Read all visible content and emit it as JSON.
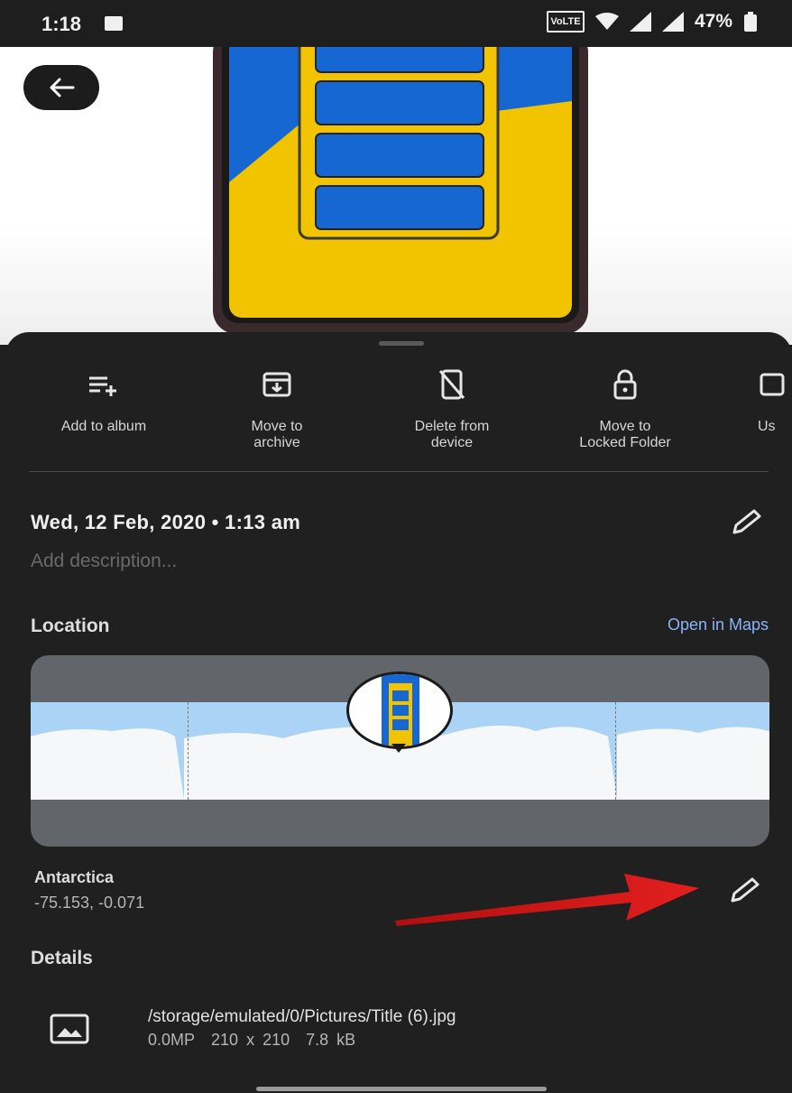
{
  "status_bar": {
    "time": "1:18",
    "network": "VoLTE",
    "battery": "47%"
  },
  "photo": {
    "subject": "phone-with-battery-graphic"
  },
  "actions": [
    {
      "label": "Add to album",
      "icon": "playlist-add-icon"
    },
    {
      "label": "Move to\narchive",
      "icon": "archive-icon"
    },
    {
      "label": "Delete from\ndevice",
      "icon": "delete-device-icon"
    },
    {
      "label": "Move to\nLocked Folder",
      "icon": "lock-icon"
    },
    {
      "label": "Us",
      "icon": "use-as-icon"
    }
  ],
  "info": {
    "date_time": "Wed, 12 Feb, 2020 • 1:13 am",
    "description_placeholder": "Add description..."
  },
  "location": {
    "title": "Location",
    "open_in_maps": "Open in Maps",
    "place": "Antarctica",
    "coordinates": "-75.153, -0.071"
  },
  "details": {
    "title": "Details",
    "path": "/storage/emulated/0/Pictures/Title (6).jpg",
    "megapixels": "0.0MP",
    "dimensions": "210 x 210",
    "size": "7.8 kB"
  },
  "colors": {
    "accent": "#8ab4f8",
    "sheet": "#202020",
    "annotation_arrow": "#d8191a"
  }
}
